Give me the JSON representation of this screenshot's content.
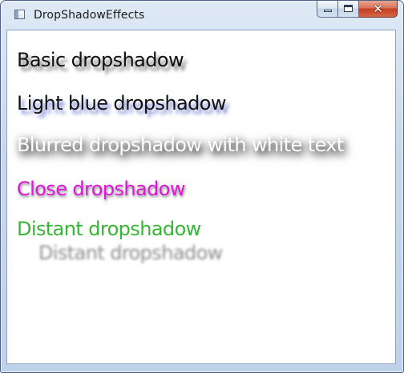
{
  "window": {
    "title": "DropShadowEffects",
    "icon": "window-app-icon"
  },
  "caption_buttons": {
    "minimize_icon": "minimize-icon",
    "maximize_icon": "maximize-icon",
    "close_icon": "close-icon",
    "close_glyph": "✕",
    "close_color": "#c94a30"
  },
  "content": {
    "basic": "Basic dropshadow",
    "light_blue": "Light blue dropshadow",
    "blurred_white": "Blurred dropshadow with white text",
    "close": "Close dropshadow",
    "distant": "Distant dropshadow"
  },
  "colors": {
    "text_default": "#111111",
    "light_blue_shadow": "#3c50be",
    "white_text": "#ffffff",
    "close_text": "#dd18d6",
    "distant_text": "#36b536"
  }
}
